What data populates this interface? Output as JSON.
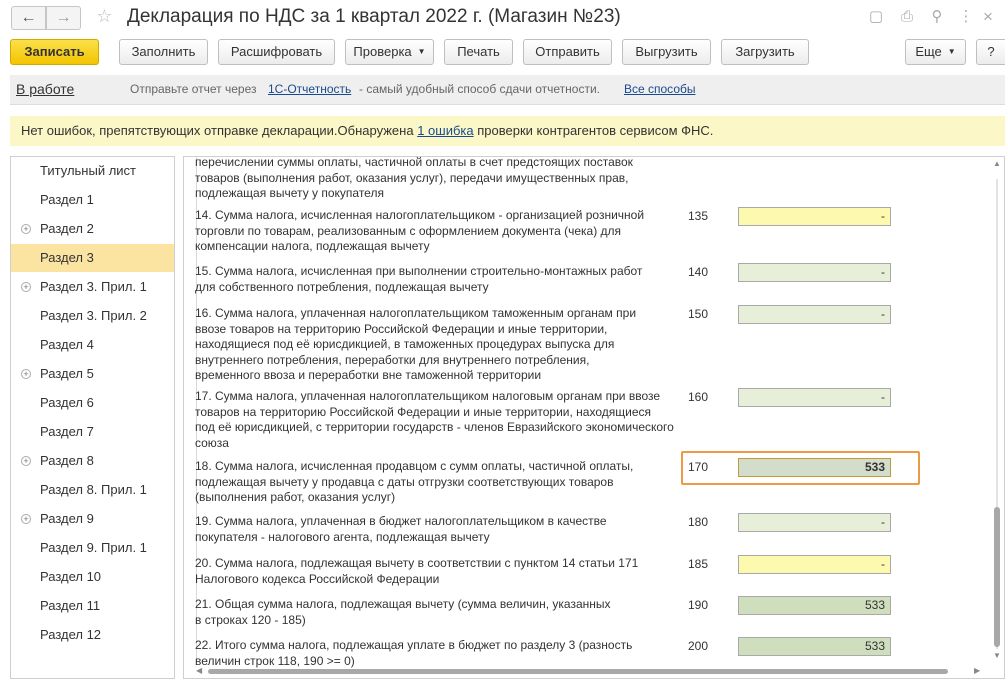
{
  "window": {
    "title": "Декларация по НДС за 1 квартал 2022 г. (Магазин №23)"
  },
  "toolbar": {
    "write": "Записать",
    "fill": "Заполнить",
    "decode": "Расшифровать",
    "check": "Проверка",
    "print": "Печать",
    "send": "Отправить",
    "export": "Выгрузить",
    "import": "Загрузить",
    "more": "Еще"
  },
  "status": {
    "state": "В работе",
    "msg_prefix": "Отправьте отчет через",
    "service_link": "1С-Отчетность",
    "msg_suffix": "- самый удобный способ сдачи отчетности.",
    "all_link": "Все способы"
  },
  "notice": {
    "prefix": "Нет ошибок, препятствующих отправке декларации.Обнаружена",
    "link": "1 ошибка",
    "suffix": "проверки контрагентов сервисом ФНС."
  },
  "sections": [
    {
      "label": "Титульный лист",
      "expand": false,
      "active": false
    },
    {
      "label": "Раздел 1",
      "expand": false,
      "active": false
    },
    {
      "label": "Раздел 2",
      "expand": true,
      "active": false
    },
    {
      "label": "Раздел 3",
      "expand": false,
      "active": true
    },
    {
      "label": "Раздел 3. Прил. 1",
      "expand": true,
      "active": false
    },
    {
      "label": "Раздел 3. Прил. 2",
      "expand": false,
      "active": false
    },
    {
      "label": "Раздел 4",
      "expand": false,
      "active": false
    },
    {
      "label": "Раздел 5",
      "expand": true,
      "active": false
    },
    {
      "label": "Раздел 6",
      "expand": false,
      "active": false
    },
    {
      "label": "Раздел 7",
      "expand": false,
      "active": false
    },
    {
      "label": "Раздел 8",
      "expand": true,
      "active": false
    },
    {
      "label": "Раздел 8. Прил. 1",
      "expand": false,
      "active": false
    },
    {
      "label": "Раздел 9",
      "expand": true,
      "active": false
    },
    {
      "label": "Раздел 9. Прил. 1",
      "expand": false,
      "active": false
    },
    {
      "label": "Раздел 10",
      "expand": false,
      "active": false
    },
    {
      "label": "Раздел 11",
      "expand": false,
      "active": false
    },
    {
      "label": "Раздел 12",
      "expand": false,
      "active": false
    }
  ],
  "form": {
    "top_text": [
      "перечислении суммы оплаты, частичной оплаты в счет предстоящих поставок",
      "товаров (выполнения работ, оказания услуг), передачи имущественных прав,",
      "подлежащая вычету у покупателя"
    ],
    "rows": [
      {
        "text": [
          "14. Сумма налога, исчисленная налогоплательщиком - организацией розничной",
          "торговли по товарам, реализованным с оформлением документа (чека) для",
          "компенсации налога, подлежащая вычету"
        ],
        "code": "135",
        "value": "-",
        "style": "yellow"
      },
      {
        "text": [
          "15. Сумма налога, исчисленная при выполнении строительно-монтажных работ",
          "для собственного потребления, подлежащая вычету"
        ],
        "code": "140",
        "value": "-",
        "style": "lgreen"
      },
      {
        "text": [
          "16. Сумма налога, уплаченная налогоплательщиком таможенным органам при",
          "ввозе товаров на территорию Российской Федерации и иные территории,",
          "находящиеся под её юрисдикцией, в таможенных процедурах выпуска для",
          "внутреннего потребления, переработки для внутреннего потребления,",
          "временного ввоза и переработки вне таможенной территории"
        ],
        "code": "150",
        "value": "-",
        "style": "lgreen"
      },
      {
        "text": [
          "17. Сумма налога, уплаченная налогоплательщиком налоговым органам при ввозе",
          "товаров на территорию Российской Федерации и иные территории, находящиеся",
          "под её юрисдикцией, с территории государств - членов Евразийского экономического",
          "союза"
        ],
        "code": "160",
        "value": "-",
        "style": "lgreen"
      },
      {
        "text": [
          "18. Сумма налога, исчисленная продавцом с сумм оплаты, частичной оплаты,",
          "подлежащая вычету у продавца с даты отгрузки соответствующих товаров",
          "(выполнения работ, оказания услуг)"
        ],
        "code": "170",
        "value": "533",
        "style": "selected"
      },
      {
        "text": [
          "19. Сумма налога, уплаченная в бюджет налогоплательщиком в качестве",
          "покупателя - налогового агента, подлежащая вычету"
        ],
        "code": "180",
        "value": "-",
        "style": "lgreen"
      },
      {
        "text": [
          "20. Сумма налога, подлежащая вычету в соответствии с пунктом 14 статьи 171",
          "Налогового кодекса Российской Федерации"
        ],
        "code": "185",
        "value": "-",
        "style": "yellow"
      },
      {
        "text": [
          "21. Общая сумма налога, подлежащая вычету (сумма величин, указанных",
          "в строках 120 - 185)"
        ],
        "code": "190",
        "value": "533",
        "style": "green"
      },
      {
        "text": [
          "22. Итого сумма налога, подлежащая уплате в бюджет по разделу 3 (разность",
          "величин строк 118, 190 >= 0)"
        ],
        "code": "200",
        "value": "533",
        "style": "green"
      }
    ]
  }
}
